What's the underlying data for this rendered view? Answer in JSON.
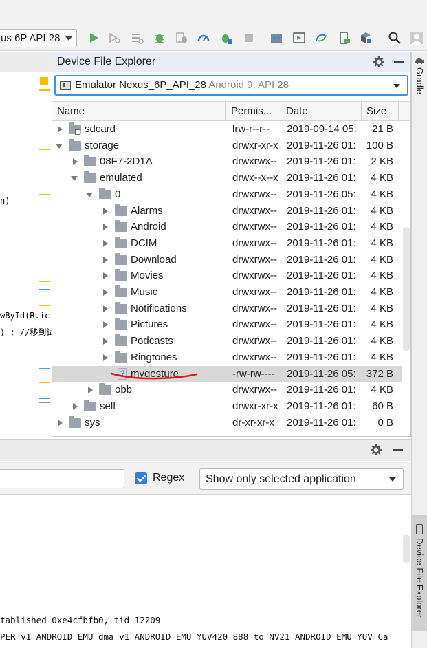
{
  "toolbar": {
    "device_selector": "us 6P API 28",
    "icons": [
      "run-icon",
      "apply-changes-icon",
      "apply-code-icon",
      "debug-icon",
      "attach-debugger-icon",
      "profile-icon",
      "attach-process-icon",
      "stop-icon",
      "project-structure-icon",
      "layout-inspector-icon",
      "sync-gradle-icon",
      "avd-manager-icon",
      "sdk-manager-icon",
      "search-icon",
      "user-icon"
    ]
  },
  "editor": {
    "code_fragments": [
      "n)",
      "wById(R.ic",
      ") ; //移到试"
    ]
  },
  "device_file_explorer": {
    "title": "Device File Explorer",
    "device": {
      "name": "Emulator Nexus_6P_API_28",
      "detail": "Android 9, API 28"
    },
    "columns": {
      "name": "Name",
      "permissions": "Permis...",
      "date": "Date",
      "size": "Size"
    },
    "rows": [
      {
        "name": "sdcard",
        "perm": "lrw-r--r--",
        "date": "2019-09-14 05:",
        "size": "21 B"
      },
      {
        "name": "storage",
        "perm": "drwxr-xr-x",
        "date": "2019-11-26 01:",
        "size": "100 B"
      },
      {
        "name": "08F7-2D1A",
        "perm": "drwxrwx--",
        "date": "2019-11-26 01:",
        "size": "2 KB"
      },
      {
        "name": "emulated",
        "perm": "drwx--x--x",
        "date": "2019-11-26 01:",
        "size": "4 KB"
      },
      {
        "name": "0",
        "perm": "drwxrwx--",
        "date": "2019-11-26 05:",
        "size": "4 KB"
      },
      {
        "name": "Alarms",
        "perm": "drwxrwx--",
        "date": "2019-11-26 01:",
        "size": "4 KB"
      },
      {
        "name": "Android",
        "perm": "drwxrwx--",
        "date": "2019-11-26 01:",
        "size": "4 KB"
      },
      {
        "name": "DCIM",
        "perm": "drwxrwx--",
        "date": "2019-11-26 01:",
        "size": "4 KB"
      },
      {
        "name": "Download",
        "perm": "drwxrwx--",
        "date": "2019-11-26 01:",
        "size": "4 KB"
      },
      {
        "name": "Movies",
        "perm": "drwxrwx--",
        "date": "2019-11-26 01:",
        "size": "4 KB"
      },
      {
        "name": "Music",
        "perm": "drwxrwx--",
        "date": "2019-11-26 01:",
        "size": "4 KB"
      },
      {
        "name": "Notifications",
        "perm": "drwxrwx--",
        "date": "2019-11-26 01:",
        "size": "4 KB"
      },
      {
        "name": "Pictures",
        "perm": "drwxrwx--",
        "date": "2019-11-26 01:",
        "size": "4 KB"
      },
      {
        "name": "Podcasts",
        "perm": "drwxrwx--",
        "date": "2019-11-26 01:",
        "size": "4 KB"
      },
      {
        "name": "Ringtones",
        "perm": "drwxrwx--",
        "date": "2019-11-26 01:",
        "size": "4 KB"
      },
      {
        "name": "mygesture",
        "perm": "-rw-rw----",
        "date": "2019-11-26 05:",
        "size": "372 B"
      },
      {
        "name": "obb",
        "perm": "drwxrwx--",
        "date": "2019-11-26 01:",
        "size": "4 KB"
      },
      {
        "name": "self",
        "perm": "drwxr-xr-x",
        "date": "2019-11-26 01:",
        "size": "60 B"
      },
      {
        "name": "sys",
        "perm": "dr-xr-xr-x",
        "date": "2019-11-26 01:",
        "size": "0 B"
      }
    ]
  },
  "side_tabs": {
    "gradle": "Gradle",
    "device_file_explorer": "Device File Explorer"
  },
  "logcat": {
    "regex_label": "Regex",
    "regex_checked": true,
    "app_filter": "Show only selected application",
    "lines": [
      "tablished 0xe4cfbfb0, tid 12209",
      "PER v1 ANDROID EMU dma v1 ANDROID EMU YUV420 888 to NV21 ANDROID EMU YUV Ca"
    ]
  },
  "colors": {
    "accent": "#3d8ee6",
    "run_green": "#59a869",
    "selection": "#d8d8d8",
    "annotation_red": "#e0191d"
  }
}
